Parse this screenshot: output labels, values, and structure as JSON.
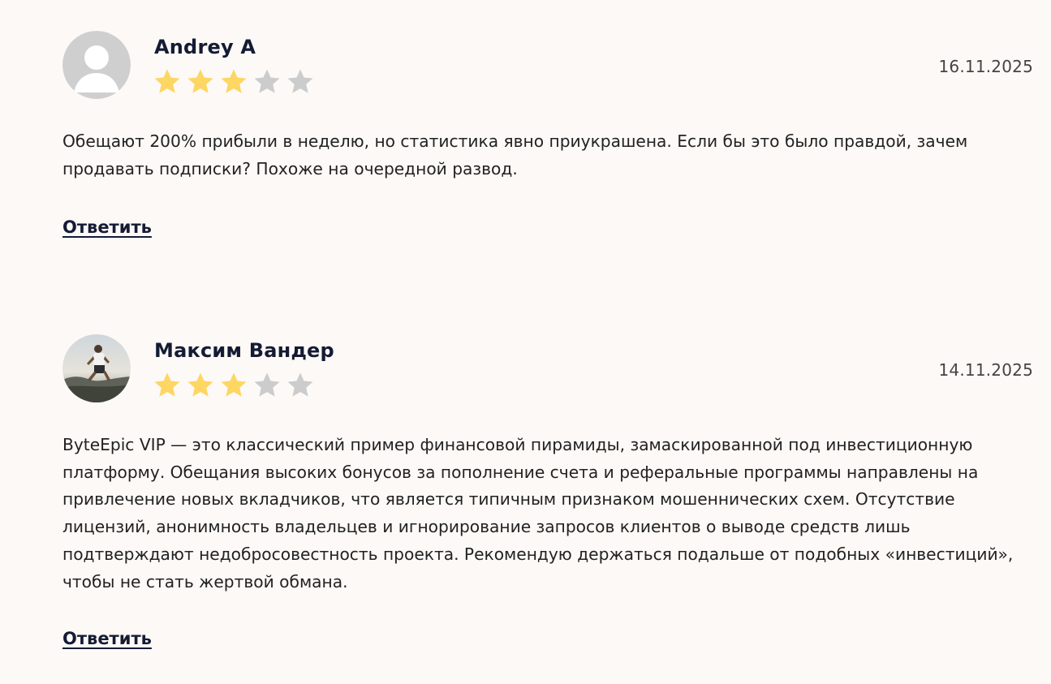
{
  "reviews": [
    {
      "author": "Andrey A",
      "avatar": "default-user-avatar",
      "rating": 3,
      "max_rating": 5,
      "date": "16.11.2025",
      "text": "Обещают 200% прибыли в неделю, но статистика явно приукрашена. Если бы это было правдой, зачем продавать подписки? Похоже на очередной развод.",
      "reply_label": "Ответить"
    },
    {
      "author": "Максим Вандер",
      "avatar": "user-photo-avatar",
      "rating": 3,
      "max_rating": 5,
      "date": "14.11.2025",
      "text": "ByteEpic VIP — это классический пример финансовой пирамиды, замаскированной под инвестиционную платформу. Обещания высоких бонусов за пополнение счета и реферальные программы направлены на привлечение новых вкладчиков, что является типичным признаком мошеннических схем. Отсутствие лицензий, анонимность владельцев и игнорирование запросов клиентов о выводе средств лишь подтверждают недобросовестность проекта. Рекомендую держаться подальше от подобных «инвестиций», чтобы не стать жертвой обмана.",
      "reply_label": "Ответить"
    }
  ],
  "colors": {
    "background": "#fdf9f6",
    "star_filled": "#fdd663",
    "star_empty": "#cccccc",
    "name": "#141b34",
    "default_avatar_bg": "#cfcfcf"
  }
}
